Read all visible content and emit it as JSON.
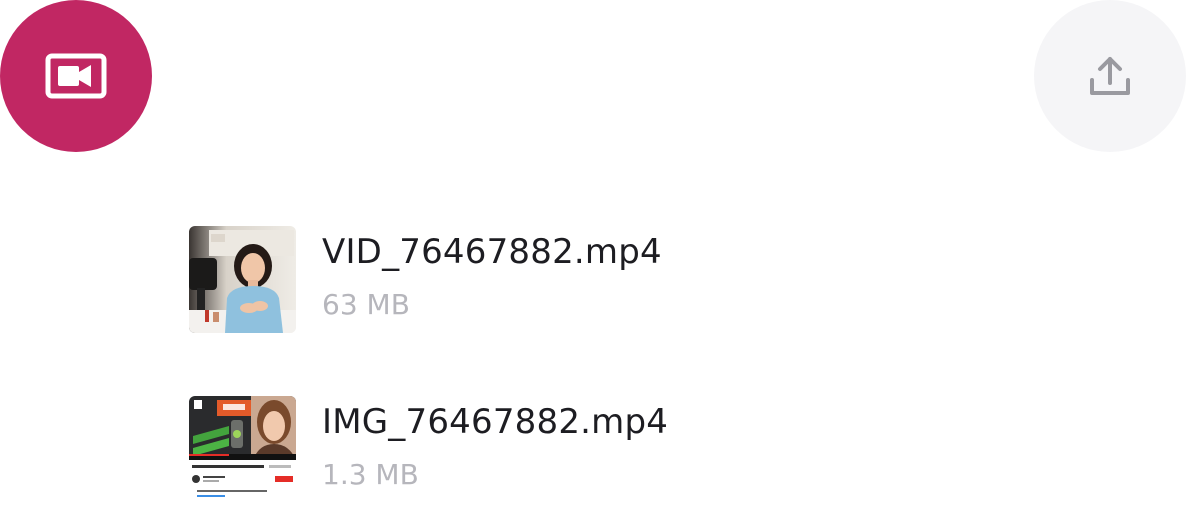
{
  "header": {
    "video_icon": "video-camera-icon",
    "upload_icon": "upload-icon",
    "accent_color": "#c12763",
    "upload_bg_color": "#f5f5f7"
  },
  "files": [
    {
      "name": "VID_76467882.mp4",
      "size": "63 MB",
      "thumbnail": "woman-at-desk-video-thumbnail"
    },
    {
      "name": "IMG_76467882.mp4",
      "size": "1.3 MB",
      "thumbnail": "youtube-video-page-thumbnail"
    }
  ]
}
